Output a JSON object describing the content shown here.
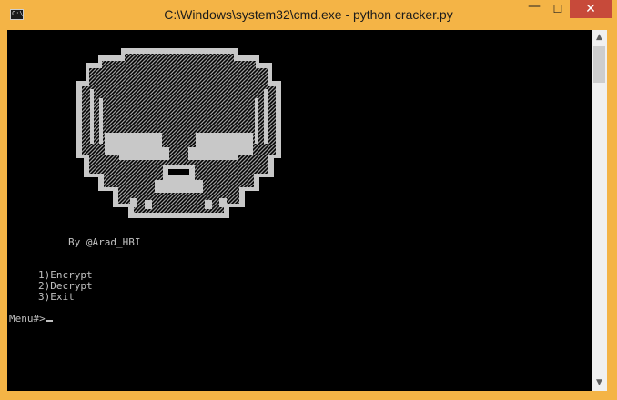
{
  "window": {
    "title": "C:\\Windows\\system32\\cmd.exe - python  cracker.py",
    "icon": "cmd-icon",
    "controls": {
      "minimize": "—",
      "maximize": "☐",
      "close": "✕"
    }
  },
  "console": {
    "art": "skull-ascii-art",
    "credit": "By @Arad_HBI",
    "menu": [
      {
        "label": "1)Encrypt"
      },
      {
        "label": "2)Decrypt"
      },
      {
        "label": "3)Exit"
      }
    ],
    "prompt": "Menu#>"
  },
  "colors": {
    "frame": "#f4b446",
    "console_bg": "#000000",
    "console_text": "#c0c0c0",
    "close_button": "#c74a3a"
  }
}
